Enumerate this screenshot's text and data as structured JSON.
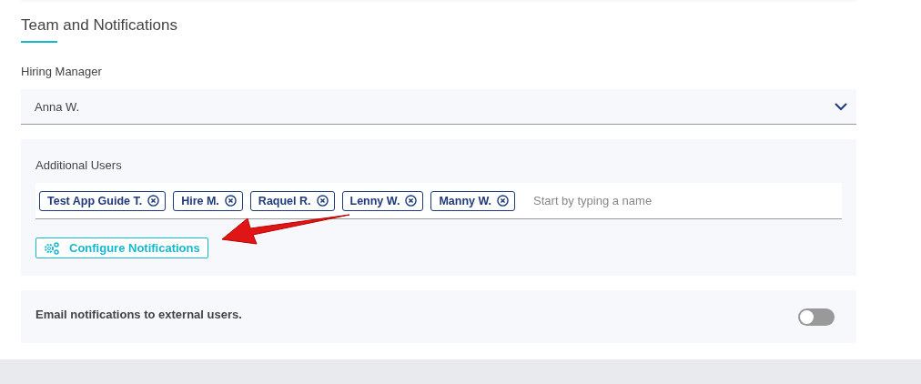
{
  "section": {
    "title": "Team and Notifications"
  },
  "hiring_manager": {
    "label": "Hiring Manager",
    "value": "Anna W."
  },
  "additional_users": {
    "label": "Additional Users",
    "chips": [
      {
        "label": "Test App Guide T."
      },
      {
        "label": "Hire M."
      },
      {
        "label": "Raquel R."
      },
      {
        "label": "Lenny W."
      },
      {
        "label": "Manny W."
      }
    ],
    "placeholder": "Start by typing a name",
    "button": "Configure Notifications"
  },
  "email_external": {
    "label": "Email notifications to external users.",
    "on": false
  }
}
